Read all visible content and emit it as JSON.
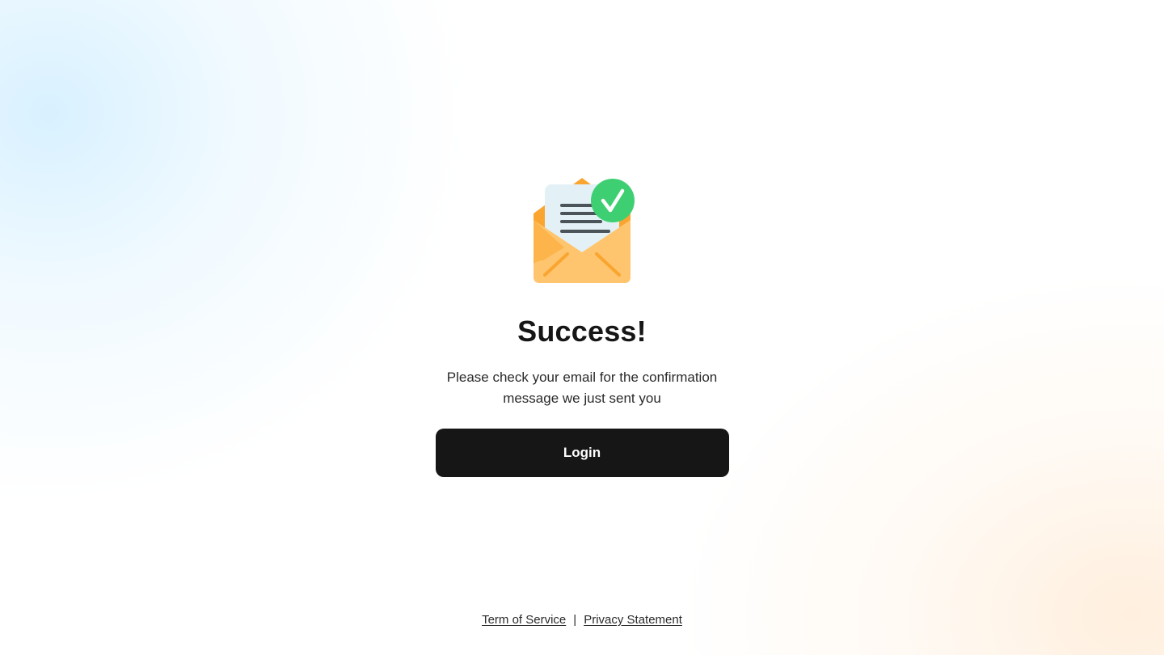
{
  "illustration": {
    "icon": "envelope-check-icon",
    "colors": {
      "envelope_back": "#f9a530",
      "envelope_front": "#ffc56e",
      "letter": "#e3f1f6",
      "letter_lines": "#4a5459",
      "check_circle": "#3ecf72",
      "check_mark": "#ffffff"
    }
  },
  "title": "Success!",
  "message": "Please check your email for the confirmation message we just sent you",
  "login_button": {
    "label": "Login",
    "background": "#161616"
  },
  "footer": {
    "terms_label": "Term of Service",
    "separator": "|",
    "privacy_label": "Privacy Statement"
  }
}
